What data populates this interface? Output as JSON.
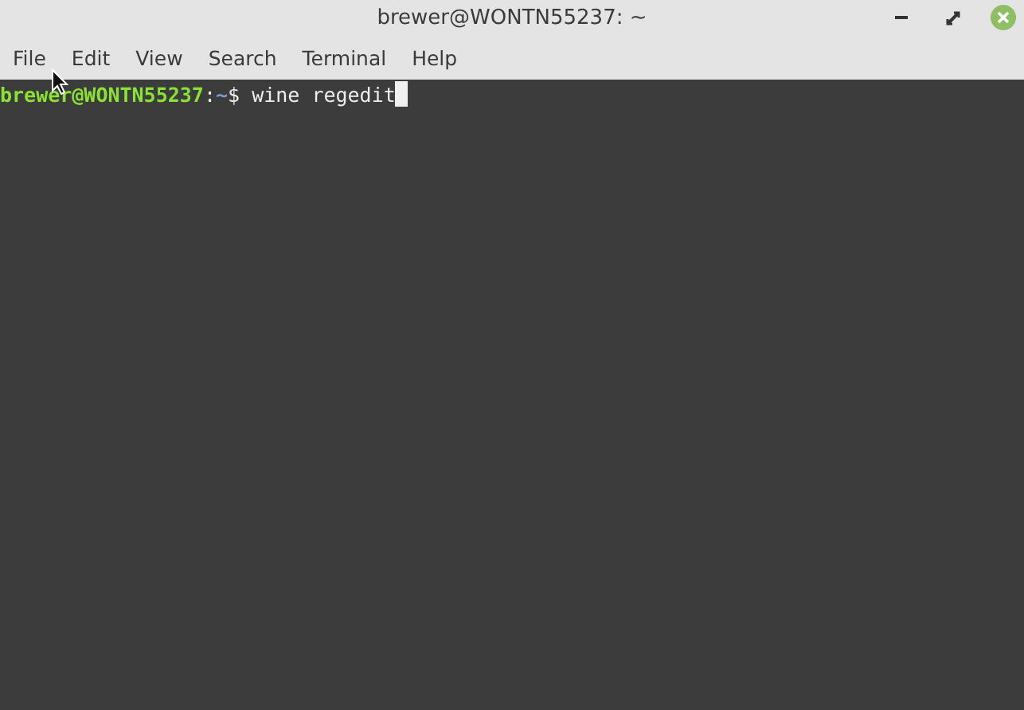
{
  "window": {
    "title": "brewer@WONTN55237: ~"
  },
  "menu": [
    {
      "label": "File"
    },
    {
      "label": "Edit"
    },
    {
      "label": "View"
    },
    {
      "label": "Search"
    },
    {
      "label": "Terminal"
    },
    {
      "label": "Help"
    }
  ],
  "terminal": {
    "prompt": {
      "user_host": "brewer@WONTN55237",
      "separator": ":",
      "path": "~",
      "symbol": "$"
    },
    "command": "wine regedit"
  }
}
